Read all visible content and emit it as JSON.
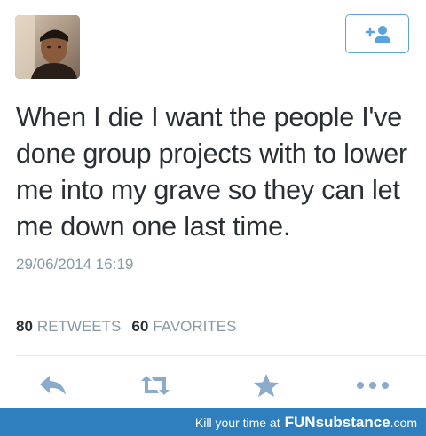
{
  "tweet": {
    "text": "When I die I want the people I've done group projects with to lower me into my grave so they can let me down one last time.",
    "timestamp": "29/06/2014 16:19"
  },
  "stats": {
    "retweets_count": "80",
    "retweets_label": "RETWEETS",
    "favorites_count": "60",
    "favorites_label": "FAVORITES"
  },
  "icons": {
    "follow": "add-user-icon",
    "reply": "reply-icon",
    "retweet": "retweet-icon",
    "favorite": "star-icon",
    "more": "more-dots-icon"
  },
  "footer": {
    "prefix": "Kill your time at",
    "brand_fun": "FUN",
    "brand_sub": "substance",
    "brand_dotcom": ".com"
  },
  "colors": {
    "accent": "#5aa3d9",
    "action_icon": "#8aabc9",
    "banner": "#2f7fbf",
    "muted_text": "#8899a6",
    "text": "#292f33"
  }
}
